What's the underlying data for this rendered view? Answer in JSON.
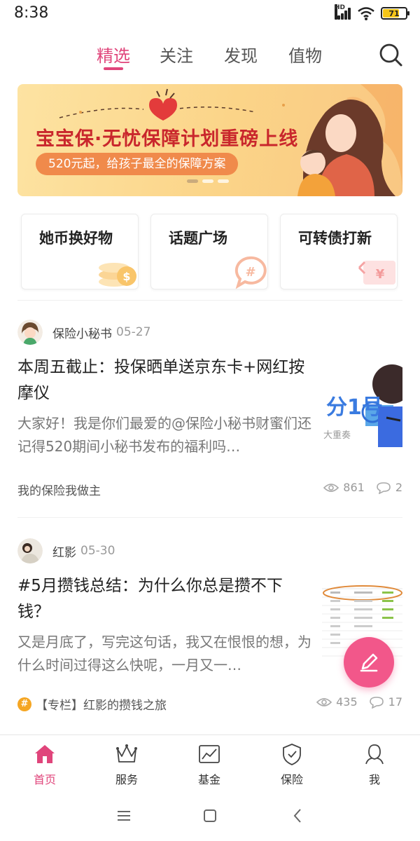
{
  "status_bar": {
    "time": "8:38",
    "network_label": "HD",
    "battery_level": "71",
    "icons": [
      "signal-icon",
      "wifi-icon",
      "battery-icon"
    ]
  },
  "top_tabs": {
    "tabs": [
      {
        "label": "精选",
        "active": true
      },
      {
        "label": "关注",
        "active": false
      },
      {
        "label": "发现",
        "active": false
      },
      {
        "label": "值物",
        "active": false
      }
    ],
    "search_icon": "search-icon"
  },
  "banner": {
    "title": "宝宝保·无忧保障计划重磅上线",
    "subtitle": "520元起，给孩子最全的保障方案",
    "page_count": 3,
    "active_page": 1
  },
  "quick_cards": [
    {
      "label": "她币换好物",
      "icon": "coin-icon"
    },
    {
      "label": "话题广场",
      "icon": "hashtag-icon"
    },
    {
      "label": "可转债打新",
      "icon": "yen-icon"
    }
  ],
  "posts": [
    {
      "author": "保险小秘书",
      "date": "05-27",
      "title": "本周五截止：投保晒单送京东卡+网红按摩仪",
      "summary": "大家好！我是你们最爱的@保险小秘书财蜜们还记得520期间小秘书发布的福利吗…",
      "thumb_text": "分1号",
      "thumb_caption": "大重奏",
      "tag": "我的保险我做主",
      "tag_is_column": false,
      "views": "861",
      "comments": "2"
    },
    {
      "author": "红影",
      "date": "05-30",
      "title": "#5月攒钱总结：为什么你总是攒不下钱？",
      "summary": "又是月底了，写完这句话，我又在恨恨的想，为什么时间过得这么快呢，一月又一…",
      "tag": "【专栏】红影的攒钱之旅",
      "tag_is_column": true,
      "views": "435",
      "comments": "17"
    }
  ],
  "fab": {
    "icon": "pencil-icon"
  },
  "bottom_nav": [
    {
      "label": "首页",
      "icon": "home-icon",
      "active": true
    },
    {
      "label": "服务",
      "icon": "crown-icon",
      "active": false
    },
    {
      "label": "基金",
      "icon": "chart-icon",
      "active": false
    },
    {
      "label": "保险",
      "icon": "shield-icon",
      "active": false
    },
    {
      "label": "我",
      "icon": "user-icon",
      "active": false
    }
  ],
  "system_nav": [
    "menu-icon",
    "home-square-icon",
    "back-icon"
  ],
  "colors": {
    "accent": "#e0457b",
    "fab": "#f2578a",
    "banner_title": "#c9262c",
    "banner_sub_bg": "#f08a4b"
  }
}
